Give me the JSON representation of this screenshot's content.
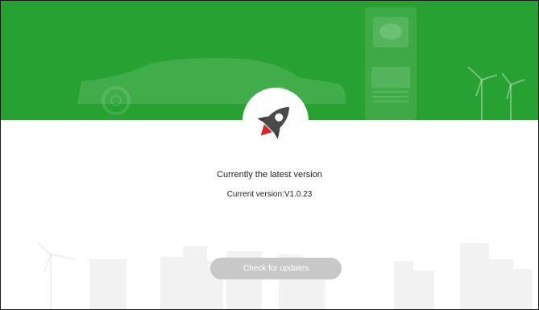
{
  "status": {
    "message": "Currently the latest version",
    "version_label": "Current version:V1.0.23"
  },
  "actions": {
    "check_updates_label": "Check for updates"
  },
  "icons": {
    "hero": "rocket-icon"
  },
  "colors": {
    "header_green": "#27a131",
    "button_gray": "#c8c8c8",
    "rocket_gray": "#4a4a4a",
    "flame_red": "#e02020"
  }
}
